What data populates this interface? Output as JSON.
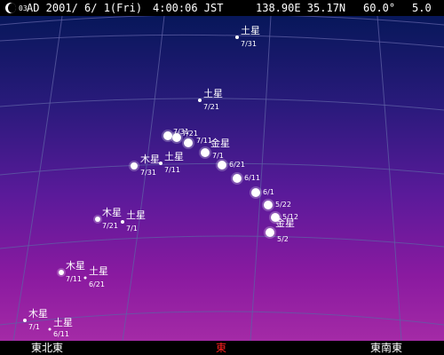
{
  "status": {
    "moon_age": "03",
    "date": "AD 2001/ 6/ 1(Fri)",
    "time": "4:00:06 JST",
    "location": "138.90E 35.17N",
    "field_of_view": "60.0°",
    "magnitude_limit": "5.0"
  },
  "directions": {
    "left": "東北東",
    "center": "東",
    "right": "東南東"
  },
  "colors": {
    "center_direction": "#ff2020",
    "side_direction": "#ffffff"
  },
  "labels": {
    "saturn": "土星",
    "jupiter": "木星",
    "venus": "金星"
  },
  "track_points": [
    {
      "name": "saturn-7-31",
      "body": "土星",
      "date": "7/31",
      "r": 2
    },
    {
      "name": "saturn-7-21",
      "body": "土星",
      "date": "7/21",
      "r": 2
    },
    {
      "name": "venus-7-31",
      "body": "",
      "date": "7/31",
      "r": 5
    },
    {
      "name": "venus-7-21",
      "body": "",
      "date": "7/21",
      "r": 5
    },
    {
      "name": "venus-7-11",
      "body": "",
      "date": "7/11",
      "r": 5
    },
    {
      "name": "venus-7-1",
      "body": "金星",
      "date": "7/1",
      "r": 5
    },
    {
      "name": "venus-6-21",
      "body": "",
      "date": "6/21",
      "r": 5
    },
    {
      "name": "venus-6-11",
      "body": "",
      "date": "6/11",
      "r": 5
    },
    {
      "name": "venus-6-1",
      "body": "",
      "date": "6/1",
      "r": 5
    },
    {
      "name": "venus-5-22",
      "body": "",
      "date": "5/22",
      "r": 5
    },
    {
      "name": "venus-5-12",
      "body": "",
      "date": "5/12",
      "r": 5
    },
    {
      "name": "venus-5-2",
      "body": "金星",
      "date": "5/2",
      "r": 5
    },
    {
      "name": "jupiter-7-31",
      "body": "木星",
      "date": "7/31",
      "r": 4
    },
    {
      "name": "saturn-7-11",
      "body": "土星",
      "date": "7/11",
      "r": 2
    },
    {
      "name": "jupiter-7-21",
      "body": "木星",
      "date": "7/21",
      "r": 3
    },
    {
      "name": "saturn-7-1",
      "body": "土星",
      "date": "7/1",
      "r": 2
    },
    {
      "name": "jupiter-7-11",
      "body": "木星",
      "date": "7/11",
      "r": 3
    },
    {
      "name": "saturn-6-21",
      "body": "土星",
      "date": "6/21",
      "r": 1.5
    },
    {
      "name": "jupiter-7-1",
      "body": "木星",
      "date": "7/1",
      "r": 2
    },
    {
      "name": "saturn-6-11",
      "body": "土星",
      "date": "6/11",
      "r": 1.5
    }
  ]
}
